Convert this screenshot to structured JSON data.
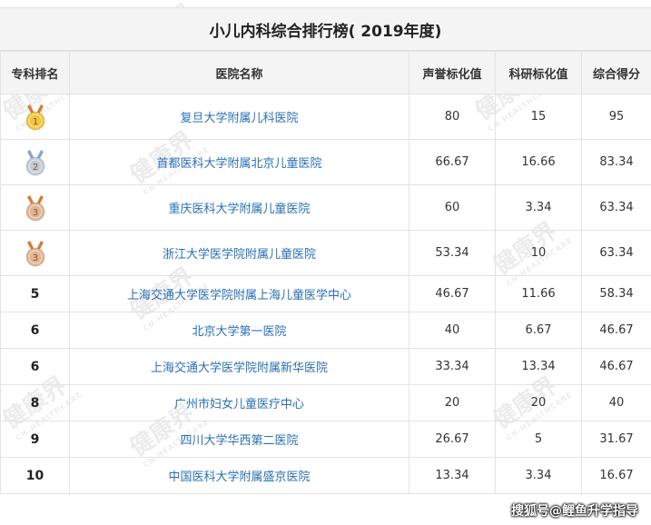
{
  "title": "小儿内科综合排行榜( 2019年度)",
  "headers": [
    "专科排名",
    "医院名称",
    "声誉标化值",
    "科研标化值",
    "综合得分"
  ],
  "rows": [
    {
      "rank": "1",
      "medal": "gold",
      "hospital": "复旦大学附属儿科医院",
      "reputation": "80",
      "research": "15",
      "score": "95"
    },
    {
      "rank": "2",
      "medal": "silver",
      "hospital": "首都医科大学附属北京儿童医院",
      "reputation": "66.67",
      "research": "16.66",
      "score": "83.34"
    },
    {
      "rank": "3",
      "medal": "bronze",
      "hospital": "重庆医科大学附属儿童医院",
      "reputation": "60",
      "research": "3.34",
      "score": "63.34"
    },
    {
      "rank": "3",
      "medal": "bronze",
      "hospital": "浙江大学医学院附属儿童医院",
      "reputation": "53.34",
      "research": "10",
      "score": "63.34"
    },
    {
      "rank": "5",
      "medal": "",
      "hospital": "上海交通大学医学院附属上海儿童医学中心",
      "reputation": "46.67",
      "research": "11.66",
      "score": "58.34"
    },
    {
      "rank": "6",
      "medal": "",
      "hospital": "北京大学第一医院",
      "reputation": "40",
      "research": "6.67",
      "score": "46.67"
    },
    {
      "rank": "6",
      "medal": "",
      "hospital": "上海交通大学医学院附属新华医院",
      "reputation": "33.34",
      "research": "13.34",
      "score": "46.67"
    },
    {
      "rank": "8",
      "medal": "",
      "hospital": "广州市妇女儿童医疗中心",
      "reputation": "20",
      "research": "20",
      "score": "40"
    },
    {
      "rank": "9",
      "medal": "",
      "hospital": "四川大学华西第二医院",
      "reputation": "26.67",
      "research": "5",
      "score": "31.67"
    },
    {
      "rank": "10",
      "medal": "",
      "hospital": "中国医科大学附属盛京医院",
      "reputation": "13.34",
      "research": "3.34",
      "score": "16.67"
    }
  ],
  "watermark": {
    "cn": "健康界",
    "en": "CN-HEALTHCARE"
  },
  "footer": "搜狐号@鲤鱼升学指导",
  "colors": {
    "hospital_link": "#2a6fb5",
    "gold": "#f2c53d",
    "silver": "#c4cad4",
    "bronze": "#e2b493"
  }
}
